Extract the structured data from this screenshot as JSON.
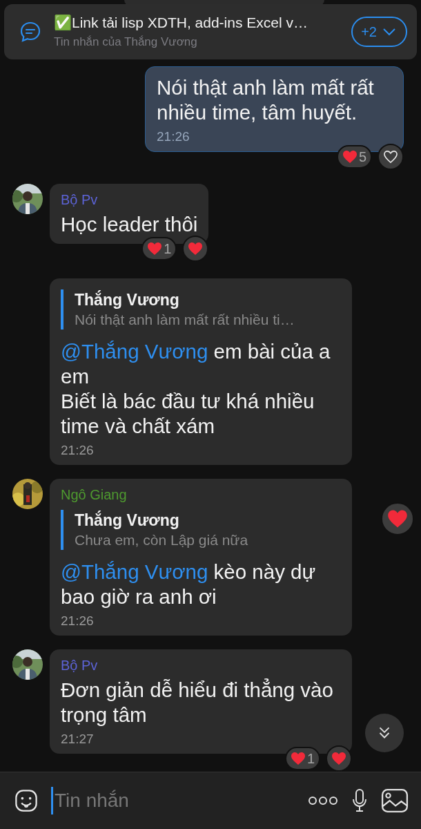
{
  "pinned": {
    "title": "✅Link tải lisp XDTH, add-ins Excel v…",
    "subtitle": "Tin nhắn của Thắng Vương",
    "more": "+2"
  },
  "messages": [
    {
      "kind": "own",
      "text": "Nói thật anh làm mất rất nhiều time, tâm huyết.",
      "time": "21:26",
      "reaction_count": "5",
      "liked": false
    },
    {
      "kind": "other",
      "sender": "Bộ Pv",
      "color": "#5c63d6",
      "text": "Học leader thôi",
      "reaction_count": "1",
      "liked": true
    },
    {
      "kind": "other",
      "quote": {
        "author": "Thắng Vương",
        "text": "Nói thật anh làm mất rất nhiều ti…"
      },
      "mention": "@Thắng Vương",
      "text": "em bài của a em\nBiết là bác đầu tư khá nhiều time và chất xám",
      "time": "21:26"
    },
    {
      "kind": "other",
      "sender": "Ngô Giang",
      "color": "#4e9a2f",
      "quote": {
        "author": "Thắng Vương",
        "text": "Chưa em, còn Lập giá nữa"
      },
      "mention": "@Thắng Vương",
      "text": "kèo này dự bao giờ ra anh ơi",
      "time": "21:26",
      "liked": true
    },
    {
      "kind": "other",
      "sender": "Bộ Pv",
      "color": "#5c63d6",
      "text": "Đơn giản dễ hiểu đi thẳng vào trọng tâm",
      "time": "21:27",
      "reaction_count": "1",
      "liked": true
    }
  ],
  "composer": {
    "placeholder": "Tin nhắn"
  }
}
